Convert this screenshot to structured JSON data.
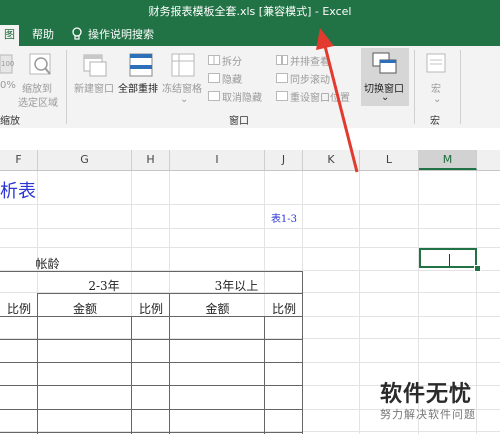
{
  "app": {
    "title": "财务报表模板全套.xls  [兼容模式]  -  Excel"
  },
  "tabs": {
    "view_partial": "图",
    "help": "帮助",
    "tell_me": "操作说明搜索"
  },
  "ribbon": {
    "zoom_pct": "0%",
    "zoom_to_selection_1": "缩放到",
    "zoom_to_selection_2": "选定区域",
    "zoom_group": "缩放",
    "new_window": "新建窗口",
    "arrange_all": "全部重排",
    "freeze_panes": "冻结窗格",
    "split": "拆分",
    "hide": "隐藏",
    "unhide": "取消隐藏",
    "view_side_by_side": "并排查看",
    "sync_scroll": "同步滚动",
    "reset_position": "重设窗口位置",
    "switch_windows": "切换窗口",
    "window_group": "窗口",
    "macros": "宏",
    "macros_group": "宏"
  },
  "columns": [
    "F",
    "G",
    "H",
    "I",
    "J",
    "K",
    "L",
    "M"
  ],
  "selected_column": "M",
  "sheet": {
    "title_partial": "析表",
    "table_no": "表1-3",
    "aging": "帐龄",
    "year_2_3": "2-3年",
    "year_3_plus": "3年以上",
    "ratio": "比例",
    "amount": "金额"
  },
  "watermark": {
    "brand": "软件无忧",
    "tagline": "努力解决软件问题"
  },
  "colors": {
    "excel_green": "#217346",
    "arrow_red": "#e23a2e",
    "text_blue": "#2a35d4"
  }
}
